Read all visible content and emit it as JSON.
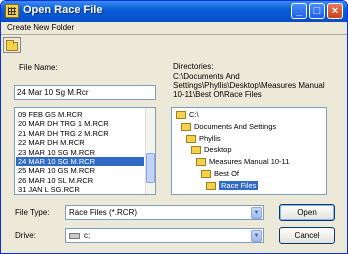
{
  "window": {
    "title": "Open Race File"
  },
  "menu": {
    "create_new_folder": "Create New Folder"
  },
  "file_name": {
    "label": "File Name:",
    "value": "24 Mar 10 Sg M.Rcr"
  },
  "files": {
    "items": [
      "09 FEB GS M.RCR",
      "20 MAR DH TRG 1 M.RCR",
      "21 MAR DH TRG 2 M.RCR",
      "22 MAR DH M.RCR",
      "23 MAR 10 SG M.RCR",
      "24 MAR 10 SG M.RCR",
      "25 MAR 10 GS M.RCR",
      "26 MAR 10 SL M.RCR",
      "31 JAN L SG.RCR"
    ],
    "selected_index": 5
  },
  "directories": {
    "label": "Directories:",
    "path": "C:\\Documents And Settings\\Phyllis\\Desktop\\Measures Manual 10-11\\Best Of\\Race Files",
    "path_lines": [
      "C:\\Documents And",
      "Settings\\Phyllis\\Desktop\\Measures Manual",
      "10-11\\Best Of\\Race Files"
    ],
    "tree": [
      {
        "label": "C:\\"
      },
      {
        "label": "Documents And Settings"
      },
      {
        "label": "Phyllis"
      },
      {
        "label": "Desktop"
      },
      {
        "label": "Measures Manual 10-11"
      },
      {
        "label": "Best Of"
      },
      {
        "label": "Race Files",
        "selected": true
      }
    ]
  },
  "file_type": {
    "label": "File Type:",
    "value": "Race Files (*.RCR)"
  },
  "drive": {
    "label": "Drive:",
    "value": "c:"
  },
  "buttons": {
    "open": "Open",
    "cancel": "Cancel"
  },
  "icons": {
    "app": "app-icon",
    "minimize": "minimize-icon",
    "maximize": "maximize-icon",
    "close": "close-icon",
    "folder": "folder-icon",
    "drive": "drive-icon"
  }
}
